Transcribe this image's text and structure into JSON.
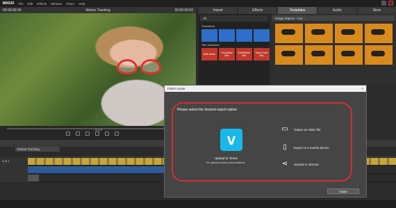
{
  "app": {
    "logo": "MAGIX",
    "menu": [
      "File",
      "Edit",
      "Effects",
      "Window",
      "Share",
      "Help"
    ]
  },
  "video": {
    "title": "Motion Tracking",
    "time_left": "00:00:00:00",
    "time_right": "00:00:00:00",
    "transport_time": "00:00"
  },
  "panel": {
    "tabs": [
      "Import",
      "Effects",
      "Templates",
      "Audio",
      "Store"
    ],
    "active_tab": "Templates",
    "left_select": "All",
    "right_select": "Image objects - Fun",
    "sections": [
      "Transitions",
      "Title templates"
    ],
    "transition_cells": [
      "",
      "",
      "",
      ""
    ],
    "title_cells": [
      "Both Mode",
      "Smoothed Blur",
      "Softclimber Blur",
      "Slow Cover Blur"
    ]
  },
  "timeline": {
    "tab": "Motion Tracking",
    "track_label": "S M 1"
  },
  "dialog": {
    "title": "Finish movie",
    "close_x": "×",
    "heading": "Please select the desired export option",
    "vimeo_label": "Upload to Vimeo",
    "vimeo_sub": "for optimal online presentations",
    "options": [
      {
        "icon": "folder-icon",
        "label": "Output as video file"
      },
      {
        "icon": "mobile-icon",
        "label": "Export to a mobile device"
      },
      {
        "icon": "share-icon",
        "label": "Upload to Internet"
      }
    ],
    "close_label": "Close"
  },
  "colors": {
    "accent_red": "#d32f2f",
    "vimeo_blue": "#1ab7ea",
    "glasses_red": "#e03030"
  }
}
